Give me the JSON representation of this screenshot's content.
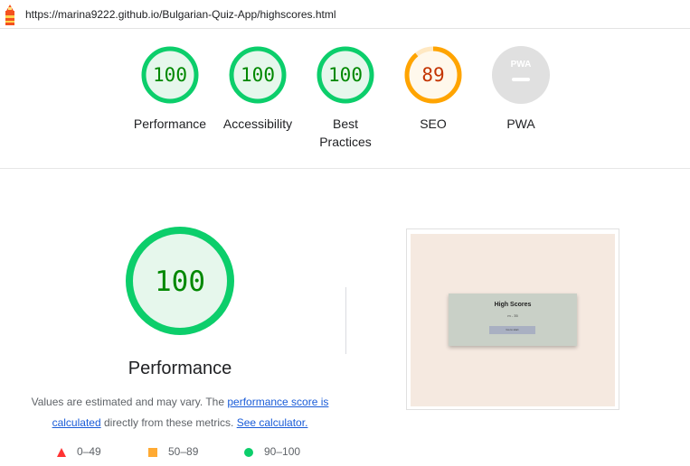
{
  "url": "https://marina9222.github.io/Bulgarian-Quiz-App/highscores.html",
  "colors": {
    "pass": "#0cce6b",
    "pass_text": "#008800",
    "pass_bg": "#e6f7ec",
    "average": "#ffa400",
    "average_text": "#c33300",
    "average_bg": "#fff8ec",
    "fail": "#ff3333",
    "na": "#e0e0e0"
  },
  "gauges": [
    {
      "id": "performance",
      "score": "100",
      "value": 100,
      "label": "Performance",
      "status": "pass"
    },
    {
      "id": "accessibility",
      "score": "100",
      "value": 100,
      "label": "Accessibility",
      "status": "pass"
    },
    {
      "id": "best-practices",
      "score": "100",
      "value": 100,
      "label": "Best Practices",
      "status": "pass"
    },
    {
      "id": "seo",
      "score": "89",
      "value": 89,
      "label": "SEO",
      "status": "average"
    },
    {
      "id": "pwa",
      "score": "PWA",
      "value": null,
      "label": "PWA",
      "status": "na"
    }
  ],
  "main": {
    "score": "100",
    "title": "Performance",
    "desc_prefix": "Values are estimated and may vary. The ",
    "desc_link1": "performance score is calculated",
    "desc_middle": " directly from these metrics. ",
    "desc_link2": "See calculator."
  },
  "legend": [
    {
      "shape": "triangle",
      "range": "0–49"
    },
    {
      "shape": "square",
      "range": "50–89"
    },
    {
      "shape": "circle",
      "range": "90–100"
    }
  ],
  "screenshot": {
    "title": "High Scores",
    "subtitle": "m - 35",
    "button": "Go to start"
  }
}
